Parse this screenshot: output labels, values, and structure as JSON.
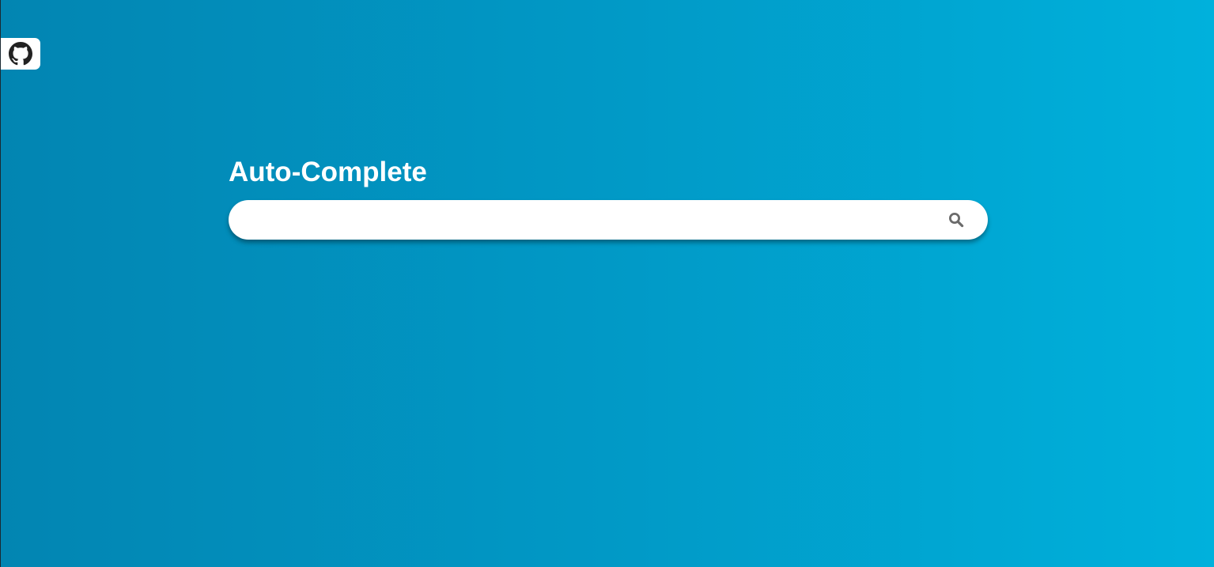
{
  "app": {
    "title": "Auto-Complete"
  },
  "github": {
    "icon": "github-icon"
  },
  "search": {
    "value": "",
    "placeholder": "",
    "icon": "search-icon"
  },
  "colors": {
    "background_start": "#0285b2",
    "background_end": "#00b1dc",
    "title_text": "#ffffff",
    "search_background": "#ffffff",
    "search_icon": "#6b6b6b",
    "github_icon": "#222222"
  }
}
